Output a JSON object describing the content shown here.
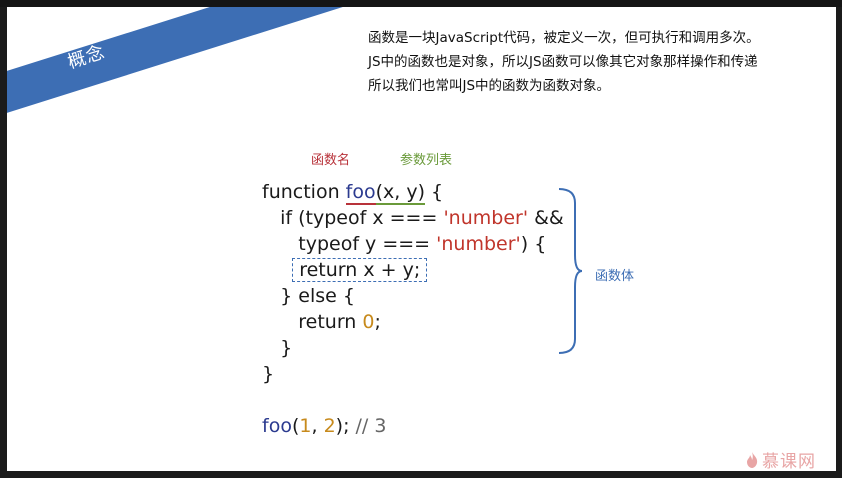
{
  "slide": {
    "banner_label": "概念",
    "intro_lines": [
      "函数是一块JavaScript代码，被定义一次，但可执行和调用多次。",
      "JS中的函数也是对象，所以JS函数可以像其它对象那样操作和传递",
      "所以我们也常叫JS中的函数为函数对象。"
    ],
    "annotations": {
      "function_name": "函数名",
      "param_list": "参数列表",
      "function_body": "函数体"
    },
    "code": {
      "l1_kw": "function ",
      "l1_name": "foo",
      "l1_params": "(x, y)",
      "l1_end": " {",
      "l2_a": "if (typeof x === ",
      "l2_str": "'number'",
      "l2_b": " &&",
      "l3_a": "typeof y === ",
      "l3_str": "'number'",
      "l3_b": ") {",
      "l4": "return x + y;",
      "l5": "} else {",
      "l6_a": "return ",
      "l6_num": "0",
      "l6_b": ";",
      "l7": "}",
      "l8": "}",
      "call_name": "foo",
      "call_open": "(",
      "call_arg1": "1",
      "call_sep": ", ",
      "call_arg2": "2",
      "call_close": ");",
      "call_comment": " // 3"
    },
    "watermark": "慕课网"
  },
  "colors": {
    "banner": "#3d6eb4",
    "function_name": "#b8323a",
    "param_list": "#6a9a3a",
    "string": "#c0352b",
    "number": "#c78a1c"
  }
}
